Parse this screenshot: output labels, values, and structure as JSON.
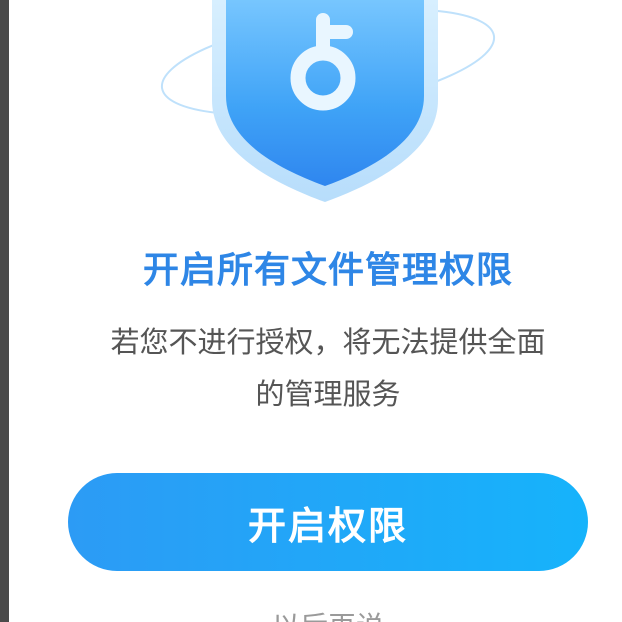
{
  "dialog": {
    "title": "开启所有文件管理权限",
    "description_line1": "若您不进行授权，将无法提供全面",
    "description_line2": "的管理服务",
    "primary_button_label": "开启权限",
    "secondary_link_label": "以后再说"
  },
  "illustration": {
    "icon": "shield-key-icon"
  },
  "colors": {
    "accent": "#2e86e6",
    "button_start": "#2c9bf5",
    "button_end": "#16b3fb",
    "text_secondary": "#555555",
    "text_muted": "#9a9a9a"
  }
}
